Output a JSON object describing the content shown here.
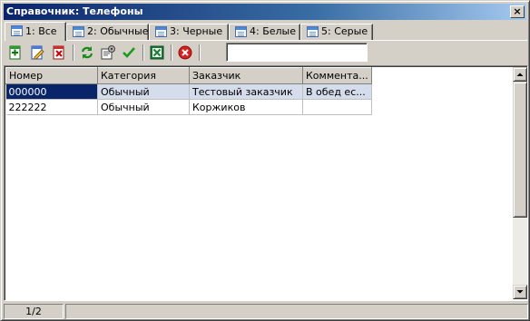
{
  "window": {
    "title": "Справочник: Телефоны",
    "close_label": "×"
  },
  "tabs": [
    {
      "label": "1: Все",
      "active": true
    },
    {
      "label": "2: Обычные"
    },
    {
      "label": "3: Черные"
    },
    {
      "label": "4: Белые"
    },
    {
      "label": "5: Серые"
    }
  ],
  "toolbar": {
    "icons": [
      "add-icon",
      "edit-icon",
      "delete-icon",
      "refresh-icon",
      "properties-icon",
      "check-icon",
      "excel-export-icon",
      "cancel-icon"
    ],
    "search_value": ""
  },
  "table": {
    "columns": [
      "Номер",
      "Категория",
      "Заказчик",
      "Коммента..."
    ],
    "rows": [
      [
        "000000",
        "Обычный",
        "Тестовый заказчик",
        "В обед ес..."
      ],
      [
        "222222",
        "Обычный",
        "Коржиков",
        ""
      ]
    ],
    "selected_row": 0
  },
  "status": {
    "record_position": "1/2"
  },
  "colors": {
    "title_gradient_start": "#0a246a",
    "selection": "#0a246a",
    "selected_row": "#d5dcec",
    "face": "#d4d0c8"
  }
}
